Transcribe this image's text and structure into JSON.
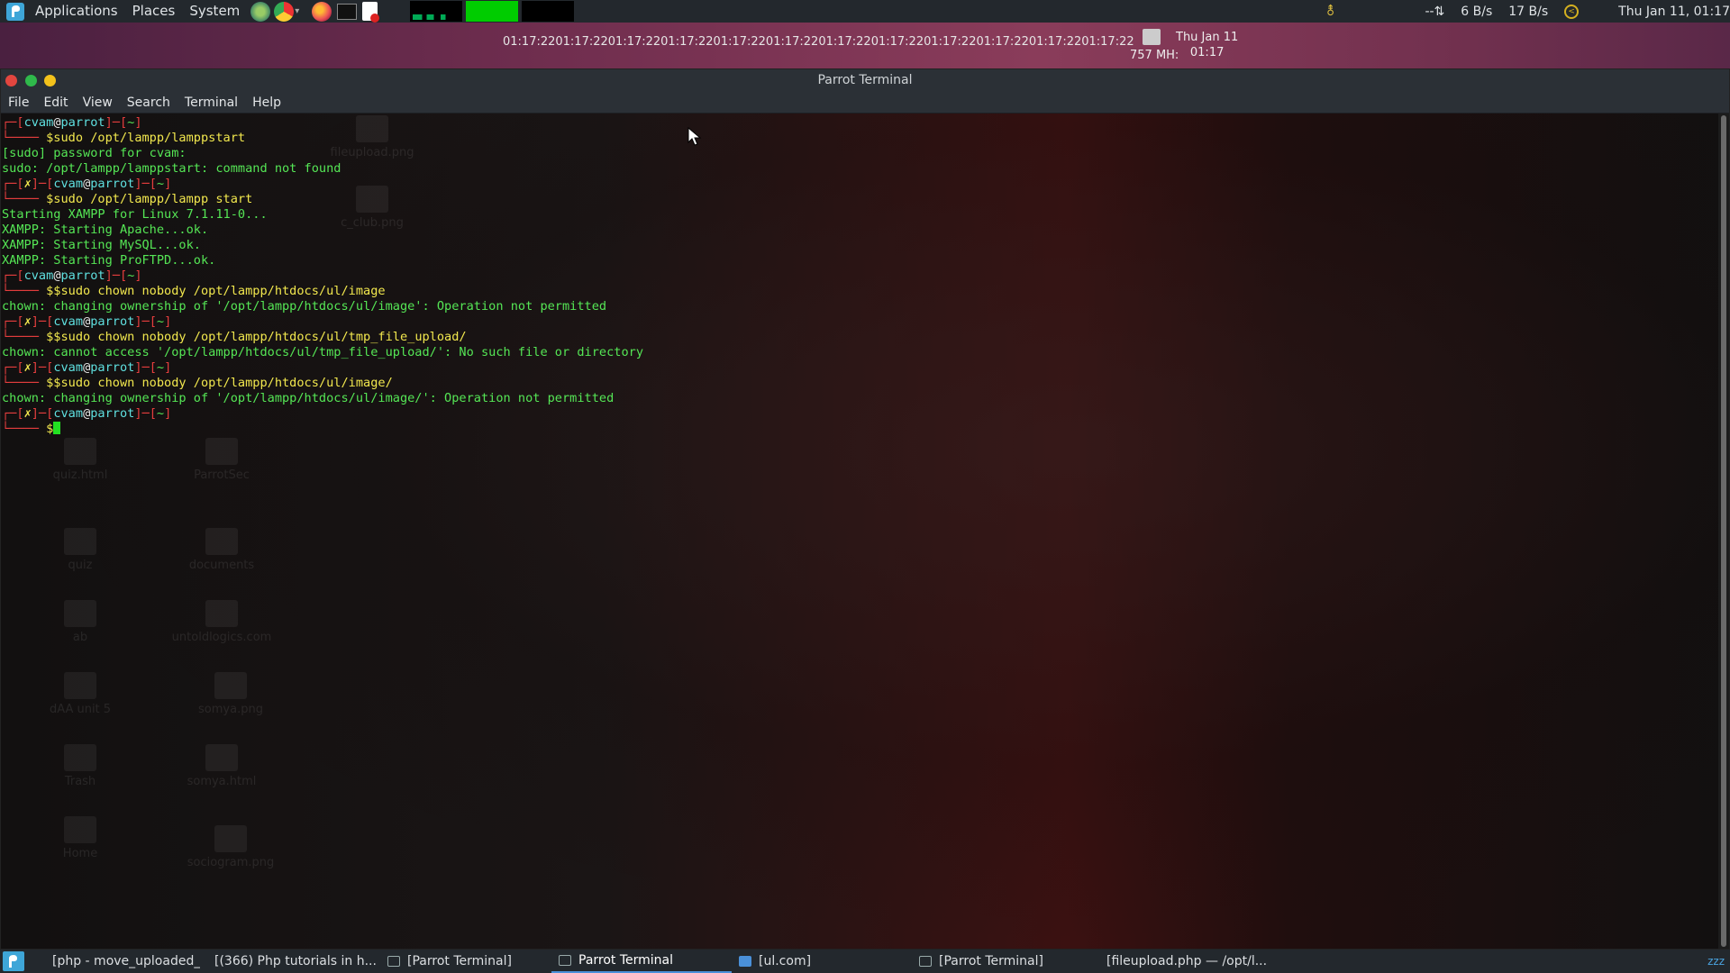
{
  "top_panel": {
    "menus": [
      "Applications",
      "Places",
      "System"
    ],
    "network_down": "6 B/s",
    "network_up": "17 B/s",
    "network_indicator": "--⇅",
    "clock": "Thu Jan 11, 01:17"
  },
  "desktop_widget": {
    "ticker": "01:17:2201:17:2201:17:2201:17:2201:17:2201:17:2201:17:2201:17:2201:17:2201:17:2201:17:2201:17:2201:17:22",
    "cpu_mhz": "757 MH:",
    "date_line1": "Thu Jan 11",
    "date_line2": "01:17"
  },
  "desktop_icons": [
    {
      "label": "fileupload.png"
    },
    {
      "label": "c_club.png"
    },
    {
      "label": "quiz.html"
    },
    {
      "label": "ParrotSec"
    },
    {
      "label": "quiz"
    },
    {
      "label": "documents"
    },
    {
      "label": "ab"
    },
    {
      "label": "untoldlogics.com"
    },
    {
      "label": "dAA unit 5"
    },
    {
      "label": "somya.png"
    },
    {
      "label": "Trash"
    },
    {
      "label": "somya.html"
    },
    {
      "label": "Home"
    },
    {
      "label": "sociogram.png"
    }
  ],
  "window": {
    "title": "Parrot Terminal",
    "menu": [
      "File",
      "Edit",
      "View",
      "Search",
      "Terminal",
      "Help"
    ]
  },
  "terminal": {
    "user": "cvam",
    "host": "parrot",
    "lines": [
      {
        "kind": "prompt1",
        "err": false
      },
      {
        "kind": "cmd",
        "text": "$sudo /opt/lampp/lamppstart"
      },
      {
        "kind": "out",
        "text": "[sudo] password for cvam:"
      },
      {
        "kind": "out",
        "text": "sudo: /opt/lampp/lamppstart: command not found"
      },
      {
        "kind": "prompt1",
        "err": true
      },
      {
        "kind": "cmd",
        "text": "$sudo /opt/lampp/lampp start"
      },
      {
        "kind": "out",
        "text": "Starting XAMPP for Linux 7.1.11-0..."
      },
      {
        "kind": "out",
        "text": "XAMPP: Starting Apache...ok."
      },
      {
        "kind": "out",
        "text": "XAMPP: Starting MySQL...ok."
      },
      {
        "kind": "out",
        "text": "XAMPP: Starting ProFTPD...ok."
      },
      {
        "kind": "prompt1",
        "err": false
      },
      {
        "kind": "cmd",
        "text": "$$sudo chown nobody /opt/lampp/htdocs/ul/image"
      },
      {
        "kind": "out",
        "text": "chown: changing ownership of '/opt/lampp/htdocs/ul/image': Operation not permitted"
      },
      {
        "kind": "prompt1",
        "err": true
      },
      {
        "kind": "cmd",
        "text": "$$sudo chown nobody /opt/lampp/htdocs/ul/tmp_file_upload/"
      },
      {
        "kind": "out",
        "text": "chown: cannot access '/opt/lampp/htdocs/ul/tmp_file_upload/': No such file or directory"
      },
      {
        "kind": "prompt1",
        "err": true
      },
      {
        "kind": "cmd",
        "text": "$$sudo chown nobody /opt/lampp/htdocs/ul/image/"
      },
      {
        "kind": "out",
        "text": "chown: changing ownership of '/opt/lampp/htdocs/ul/image/': Operation not permitted"
      },
      {
        "kind": "prompt1",
        "err": true
      },
      {
        "kind": "cursor",
        "text": "$"
      }
    ]
  },
  "taskbar": {
    "items": [
      {
        "label": "[php - move_uploaded_...",
        "icon": "browser",
        "active": false
      },
      {
        "label": "[(366) Php tutorials in h...",
        "icon": "browser",
        "active": false
      },
      {
        "label": "[Parrot Terminal]",
        "icon": "terminal",
        "active": false
      },
      {
        "label": "Parrot Terminal",
        "icon": "terminal",
        "active": true
      },
      {
        "label": "[ul.com]",
        "icon": "folder",
        "active": false
      },
      {
        "label": "[Parrot Terminal]",
        "icon": "terminal",
        "active": false
      },
      {
        "label": "[fileupload.php — /opt/l...",
        "icon": "editor",
        "active": false
      }
    ]
  },
  "colors": {
    "panel": "#23282d",
    "prompt_bracket": "#e63e3e",
    "prompt_user": "#5fe0e0",
    "prompt_host": "#5fe0e0",
    "command": "#f2e84e",
    "output": "#55e655"
  }
}
